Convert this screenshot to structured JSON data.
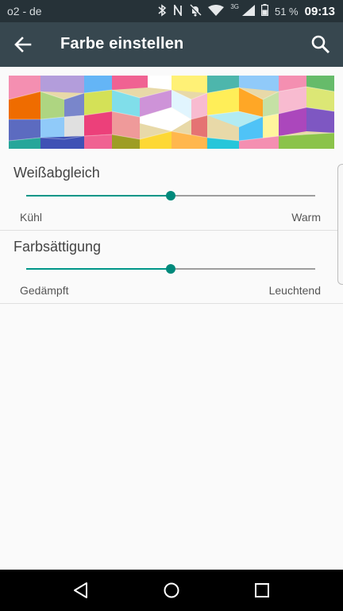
{
  "status_bar": {
    "carrier": "o2 - de",
    "network": "3G",
    "battery": "51 %",
    "time": "09:13"
  },
  "app_bar": {
    "title": "Farbe einstellen"
  },
  "settings": [
    {
      "label": "Weißabgleich",
      "min_label": "Kühl",
      "max_label": "Warm",
      "level_percent": 50
    },
    {
      "label": "Farbsättigung",
      "min_label": "Gedämpft",
      "max_label": "Leuchtend",
      "level_percent": 50
    }
  ],
  "colors": {
    "accent": "#009688",
    "app_bar": "#37474f",
    "status_bar": "#263238"
  }
}
